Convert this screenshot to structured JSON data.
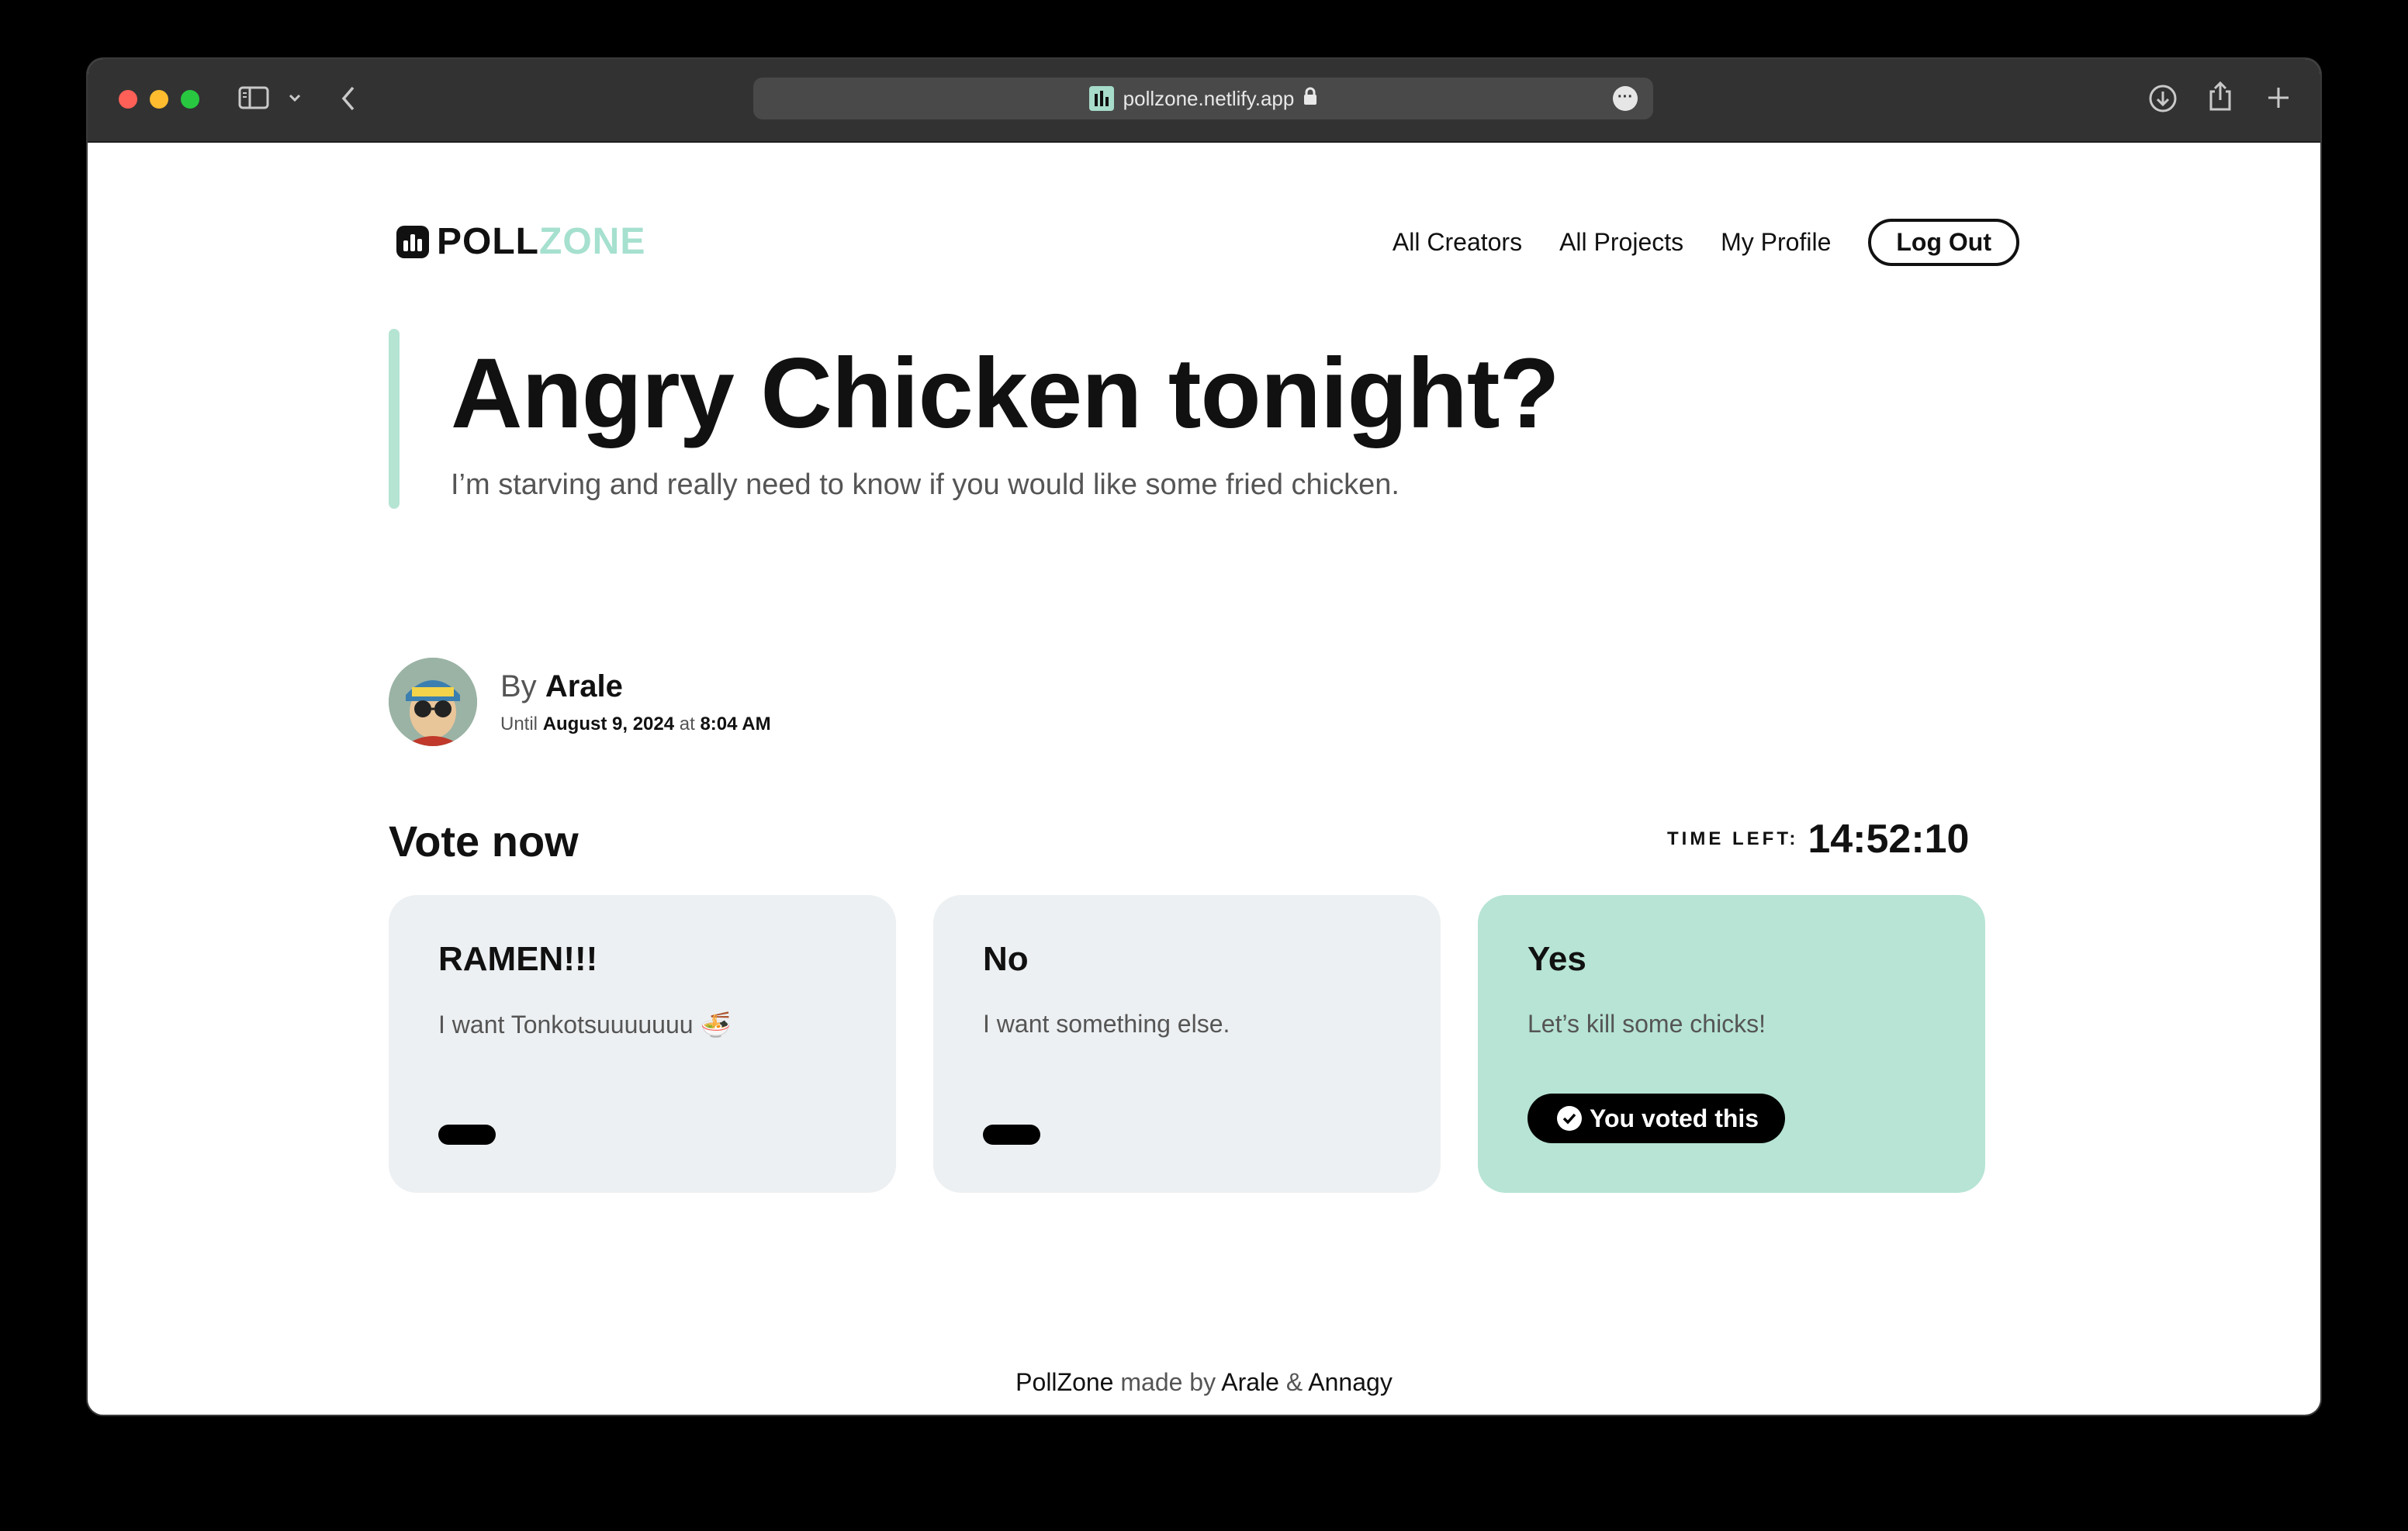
{
  "browser": {
    "url": "pollzone.netlify.app"
  },
  "logo": {
    "poll": "POLL",
    "zone": "ZONE"
  },
  "nav": {
    "all_creators": "All Creators",
    "all_projects": "All Projects",
    "my_profile": "My Profile",
    "log_out": "Log Out"
  },
  "poll": {
    "title": "Angry Chicken tonight?",
    "description": "I’m starving and really need to know if you would like some fried chicken.",
    "by_prefix": "By",
    "author": "Arale",
    "until_prefix": "Until",
    "until_date": "August 9, 2024",
    "at": "at",
    "until_time": "8:04 AM"
  },
  "vote": {
    "heading": "Vote now",
    "time_left_label": "TIME LEFT:",
    "time_left": "14:52:10",
    "options": [
      {
        "title": "RAMEN!!!",
        "description": "I want Tonkotsuuuuuuu 🍜",
        "voted": false
      },
      {
        "title": "No",
        "description": "I want something else.",
        "voted": false
      },
      {
        "title": "Yes",
        "description": "Let’s kill some chicks!",
        "voted": true,
        "voted_label": "You voted this"
      }
    ]
  },
  "footer": {
    "brand": "PollZone",
    "made_by": "made by",
    "author1": "Arale",
    "amp": "&",
    "author2": "Annagy"
  },
  "colors": {
    "accent": "#b7e4d4",
    "card_bg": "#edf0f2"
  }
}
